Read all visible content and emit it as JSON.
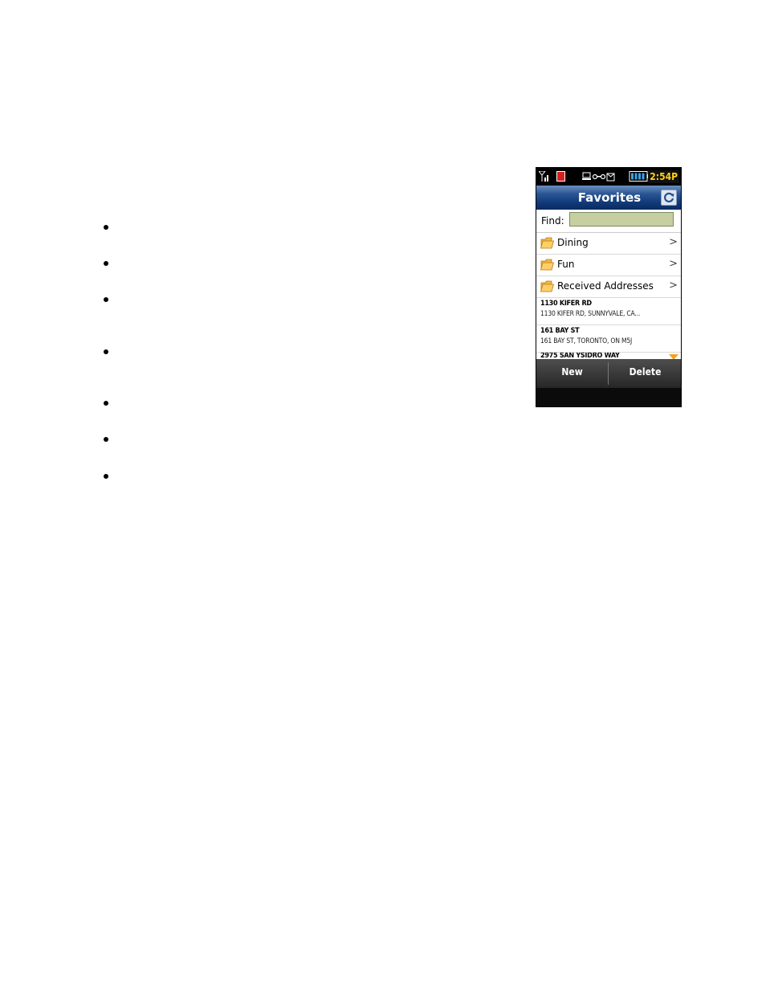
{
  "document": {
    "bullet_count": 7
  },
  "phone": {
    "status_bar": {
      "time": "2:54P",
      "icons": [
        "signal-icon",
        "alert-icon",
        "connection-icon",
        "key-icon",
        "message-icon",
        "battery-icon"
      ]
    },
    "title_bar": {
      "title": "Favorites",
      "refresh_icon": "refresh-icon"
    },
    "find": {
      "label": "Find:",
      "value": "",
      "placeholder": ""
    },
    "folders": [
      {
        "label": "Dining",
        "icon": "folder-icon"
      },
      {
        "label": "Fun",
        "icon": "folder-icon"
      },
      {
        "label": "Received Addresses",
        "icon": "folder-icon"
      }
    ],
    "addresses": [
      {
        "title": "1130 KIFER RD",
        "detail": "1130 KIFER RD, SUNNYVALE, CA..."
      },
      {
        "title": "161 BAY ST",
        "detail": "161 BAY ST, TORONTO, ON M5J"
      },
      {
        "title": "2975 SAN YSIDRO WAY",
        "detail": ""
      }
    ],
    "softkeys": {
      "left": "New",
      "right": "Delete"
    },
    "colors": {
      "title_bar": "#113a79",
      "find_field": "#c5cf9f",
      "time_text": "#ffd21a",
      "scroll_arrow": "#f5a21e"
    }
  }
}
